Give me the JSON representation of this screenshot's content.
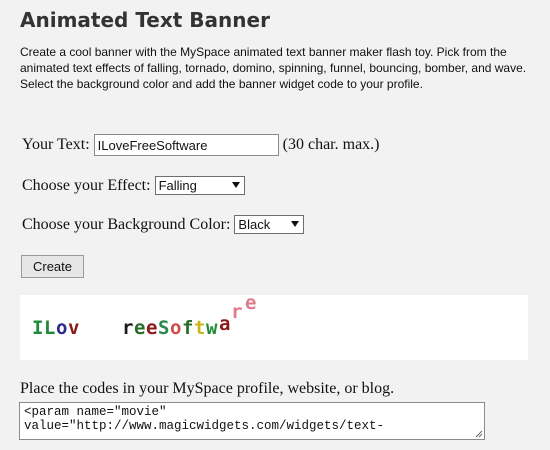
{
  "page": {
    "title": "Animated Text Banner",
    "description": "Create a cool banner with the MySpace animated text banner maker flash toy. Pick from the animated text effects of falling, tornado, domino, spinning, funnel, bouncing, bomber, and wave. Select the background color and add the banner widget code to your profile."
  },
  "form": {
    "text_label": "Your Text:",
    "text_value": "ILoveFreeSoftware",
    "text_hint": "(30 char. max.)",
    "effect_label": "Choose your Effect:",
    "effect_value": "Falling",
    "bg_label": "Choose your Background Color:",
    "bg_value": "Black",
    "create_label": "Create"
  },
  "banner": {
    "letters": [
      {
        "char": "I",
        "color": "#1f8a3a"
      },
      {
        "char": "L",
        "color": "#1f8a3a"
      },
      {
        "char": "o",
        "color": "#2a2a8c"
      },
      {
        "char": "v",
        "color": "#8a1a1a"
      },
      {
        "char": "r",
        "color": "#1a1a1a"
      },
      {
        "char": "e",
        "color": "#2a6a2a"
      },
      {
        "char": "e",
        "color": "#8a1a1a"
      },
      {
        "char": "S",
        "color": "#2a8a4a"
      },
      {
        "char": "o",
        "color": "#d14a4a"
      },
      {
        "char": "f",
        "color": "#2a6a2a"
      },
      {
        "char": "t",
        "color": "#c8b81a"
      },
      {
        "char": "w",
        "color": "#1f8a3a"
      },
      {
        "char": "a",
        "color": "#8a1a1a"
      },
      {
        "char": "r",
        "color": "#e07a8a"
      },
      {
        "char": "e",
        "color": "#e07a8a"
      }
    ]
  },
  "code": {
    "label": "Place the codes in your MySpace profile, website, or blog.",
    "value": "<param name=\"movie\"\nvalue=\"http://www.magicwidgets.com/widgets/text-"
  }
}
